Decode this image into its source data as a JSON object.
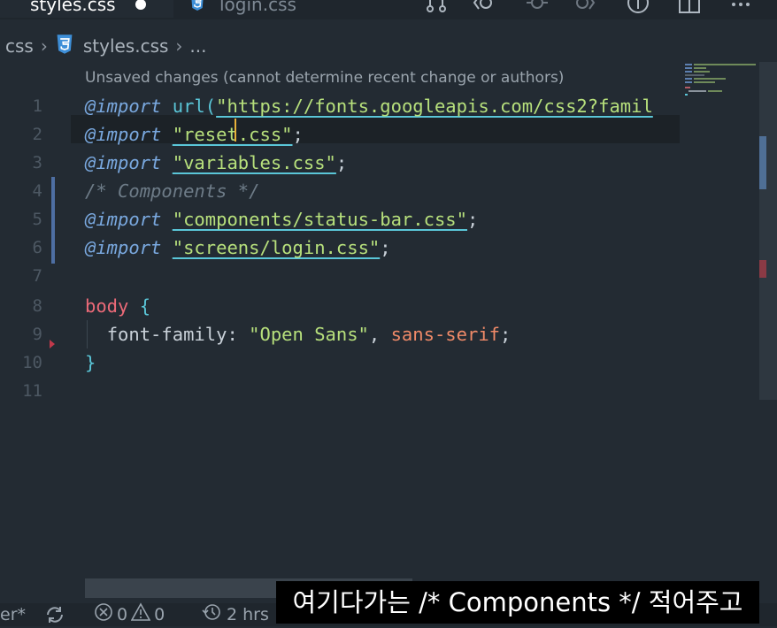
{
  "tabs": [
    {
      "label": "styles.css",
      "modified": true
    },
    {
      "label": "login.css"
    }
  ],
  "breadcrumb": {
    "folder": "css",
    "file": "styles.css",
    "more": "..."
  },
  "editor": {
    "blame": "Unsaved changes (cannot determine recent change or authors)",
    "line_numbers": [
      "1",
      "2",
      "3",
      "4",
      "5",
      "6",
      "7",
      "8",
      "9",
      "10",
      "11"
    ],
    "code": {
      "l1_kw": "@import",
      "l1_fn": "url(",
      "l1_str": "\"https://fonts.googleapis.com/css2?famil",
      "l2_kw": "@import",
      "l2_str": "\"reset.css\"",
      "l2_end": ";",
      "l3_kw": "@import",
      "l3_str": "\"variables.css\"",
      "l3_end": ";",
      "l4_cmt_a": "/* Components",
      "l4_cmt_b": " */",
      "l5_kw": "@import",
      "l5_str": "\"components/status-bar.css\"",
      "l5_end": ";",
      "l6_kw": "@import",
      "l6_str": "\"screens/login.css\"",
      "l6_end": ";",
      "l8_sel": "body",
      "l8_brace": "{",
      "l9_prop": "font-family",
      "l9_colon": ": ",
      "l9_str": "\"Open Sans\"",
      "l9_comma": ", ",
      "l9_kwval": "sans-serif",
      "l9_end": ";",
      "l10_brace": "}"
    }
  },
  "statusbar": {
    "branch_fragment": "er*",
    "errors": "0",
    "warnings": "0",
    "time": "2 hrs"
  },
  "subtitle": "여기다가는 /* Components */ 적어주고",
  "colors": {
    "accent": "#4e6fa3",
    "cursor": "#e8b23a",
    "css_icon": "#3e8fd8"
  }
}
